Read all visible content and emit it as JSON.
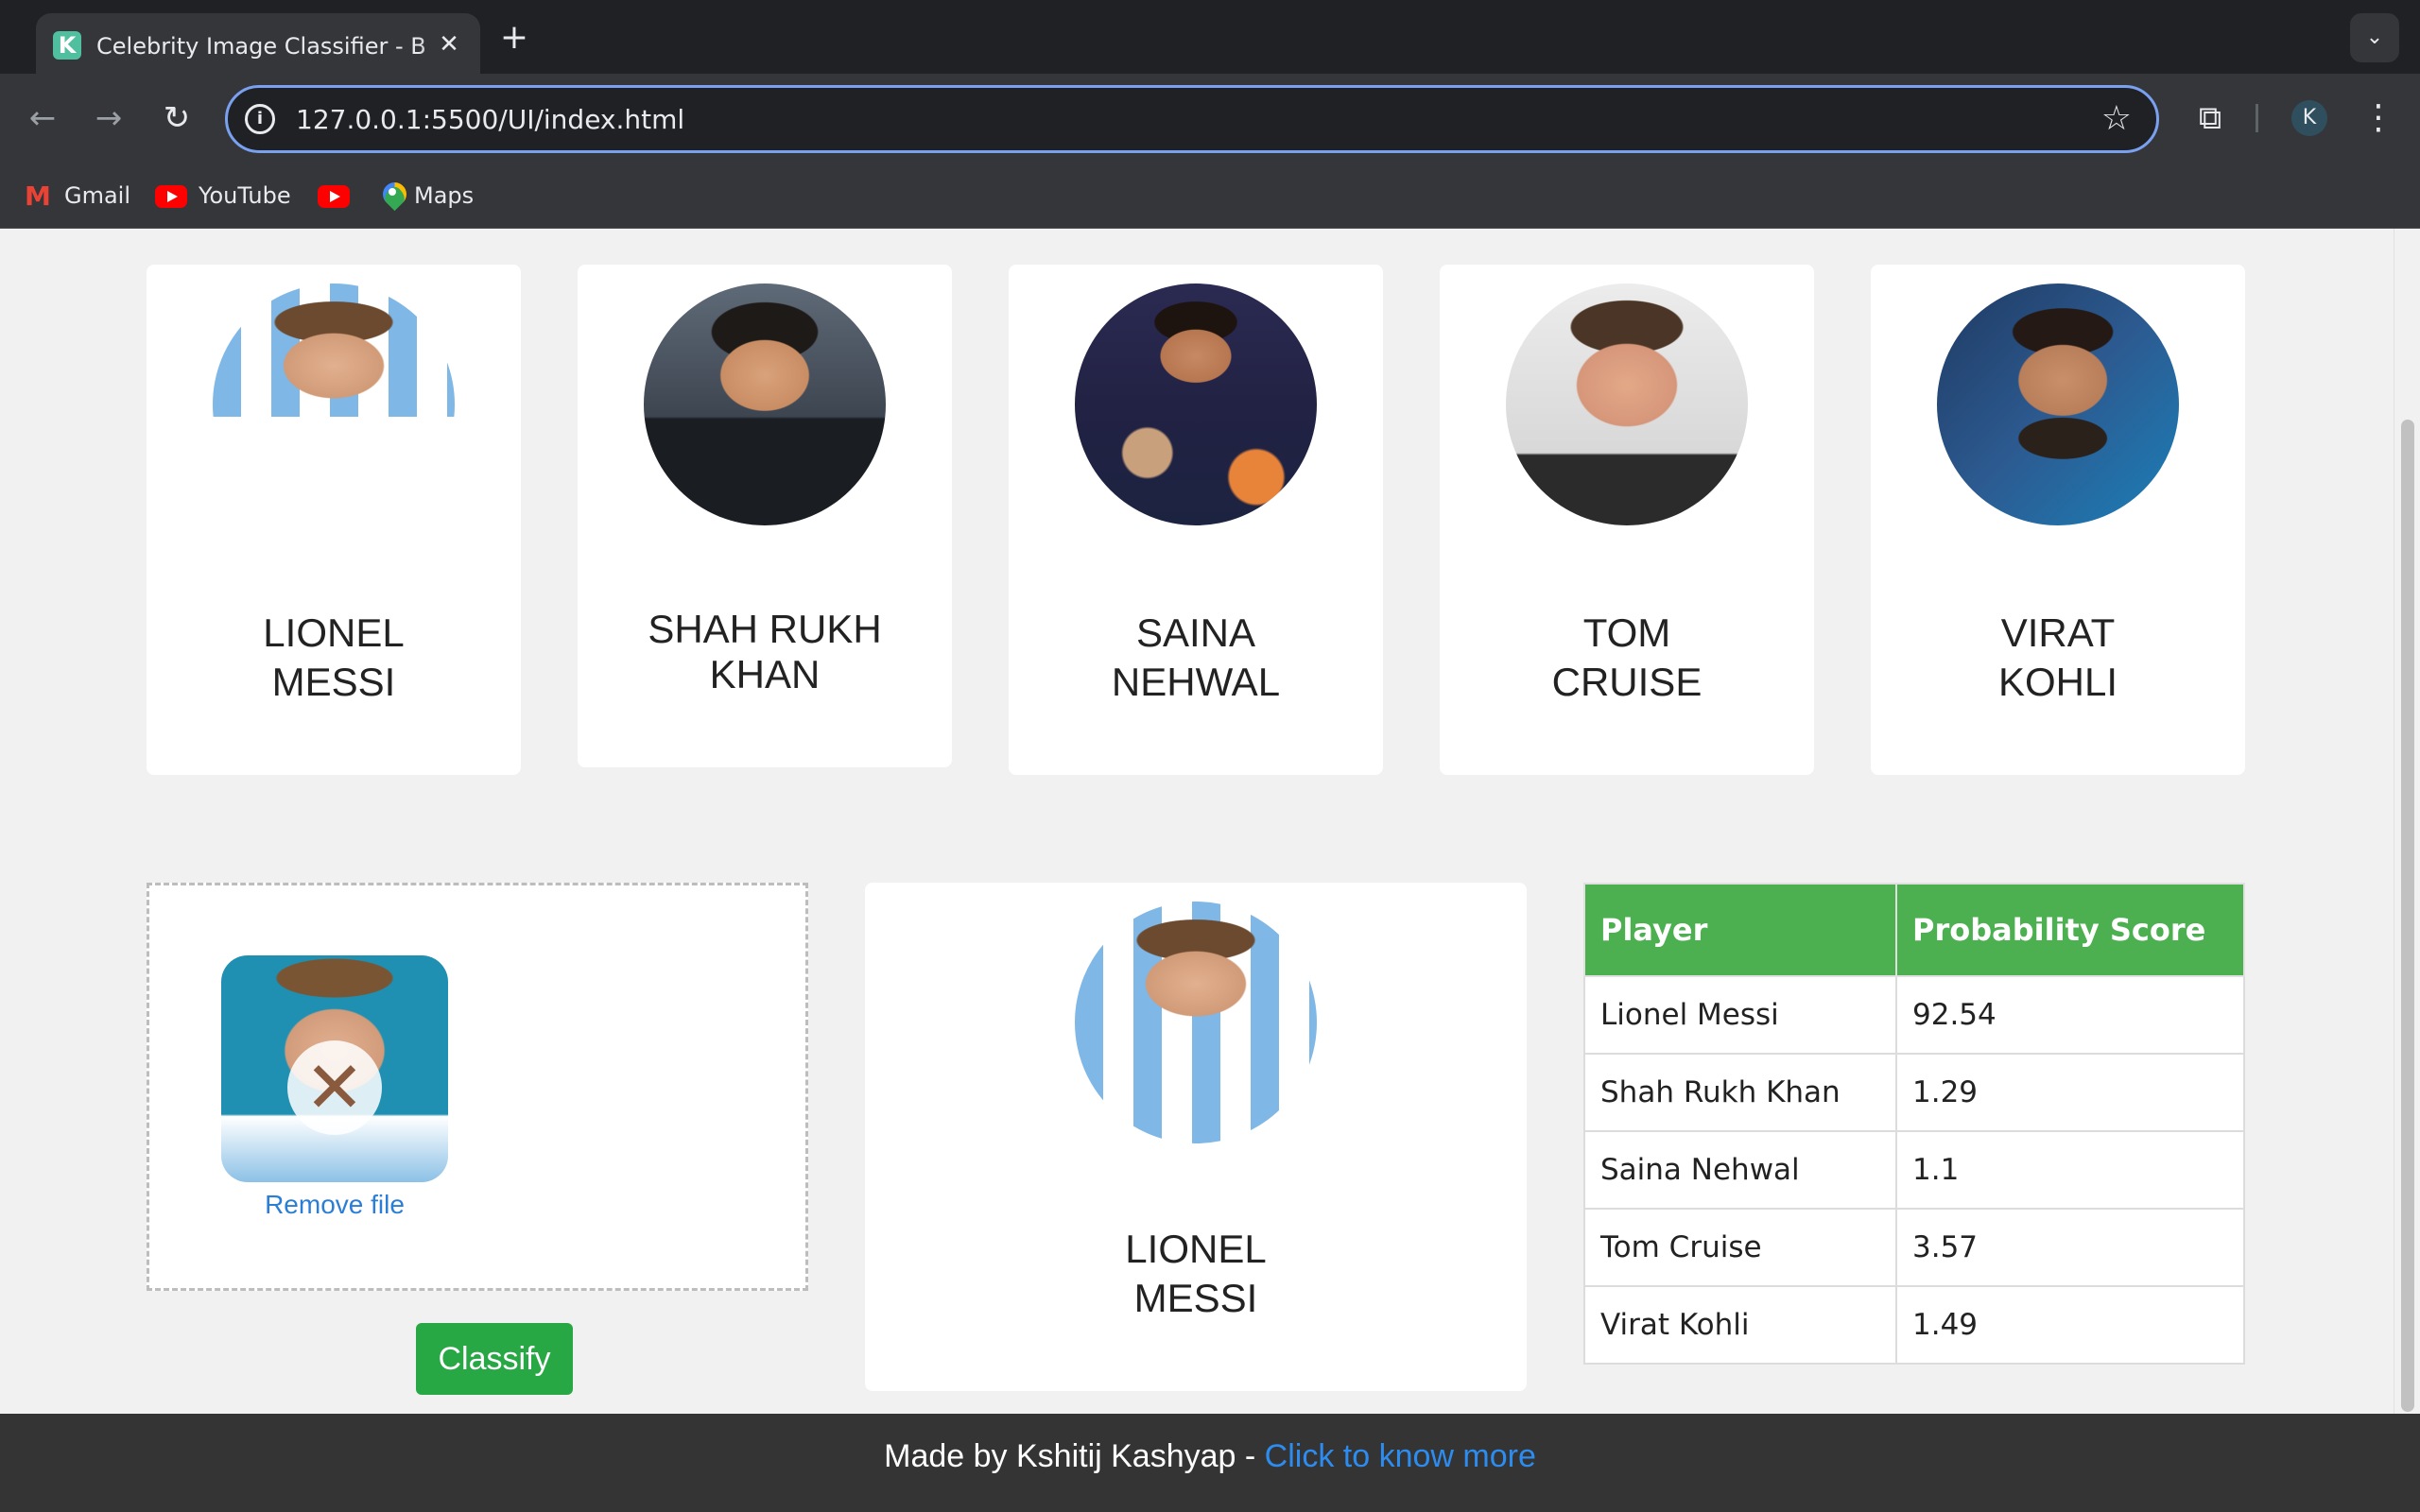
{
  "browser": {
    "tab_title": "Celebrity Image Classifier - B",
    "tab_favicon_letter": "K",
    "url": "127.0.0.1:5500/UI/index.html",
    "profile_initial": "K",
    "bookmarks": [
      "Gmail",
      "YouTube",
      "",
      "Maps"
    ]
  },
  "celebrities": [
    {
      "line1": "LIONEL",
      "line2": "MESSI"
    },
    {
      "line1": "SHAH RUKH",
      "line2": "KHAN"
    },
    {
      "line1": "SAINA",
      "line2": "NEHWAL"
    },
    {
      "line1": "TOM",
      "line2": "CRUISE"
    },
    {
      "line1": "VIRAT",
      "line2": "KOHLI"
    }
  ],
  "upload": {
    "remove_label": "Remove file",
    "classify_label": "Classify"
  },
  "result": {
    "line1": "LIONEL",
    "line2": "MESSI"
  },
  "scores": {
    "headers": [
      "Player",
      "Probability Score"
    ],
    "rows": [
      [
        "Lionel Messi",
        "92.54"
      ],
      [
        "Shah Rukh Khan",
        "1.29"
      ],
      [
        "Saina Nehwal",
        "1.1"
      ],
      [
        "Tom Cruise",
        "3.57"
      ],
      [
        "Virat Kohli",
        "1.49"
      ]
    ]
  },
  "footer": {
    "text": "Made by Kshitij Kashyap - ",
    "link": "Click to know more"
  },
  "colors": {
    "accent_green": "#4caf50",
    "button_green": "#28a745",
    "link_blue": "#2b7ed6",
    "footer_bg": "#343434"
  }
}
